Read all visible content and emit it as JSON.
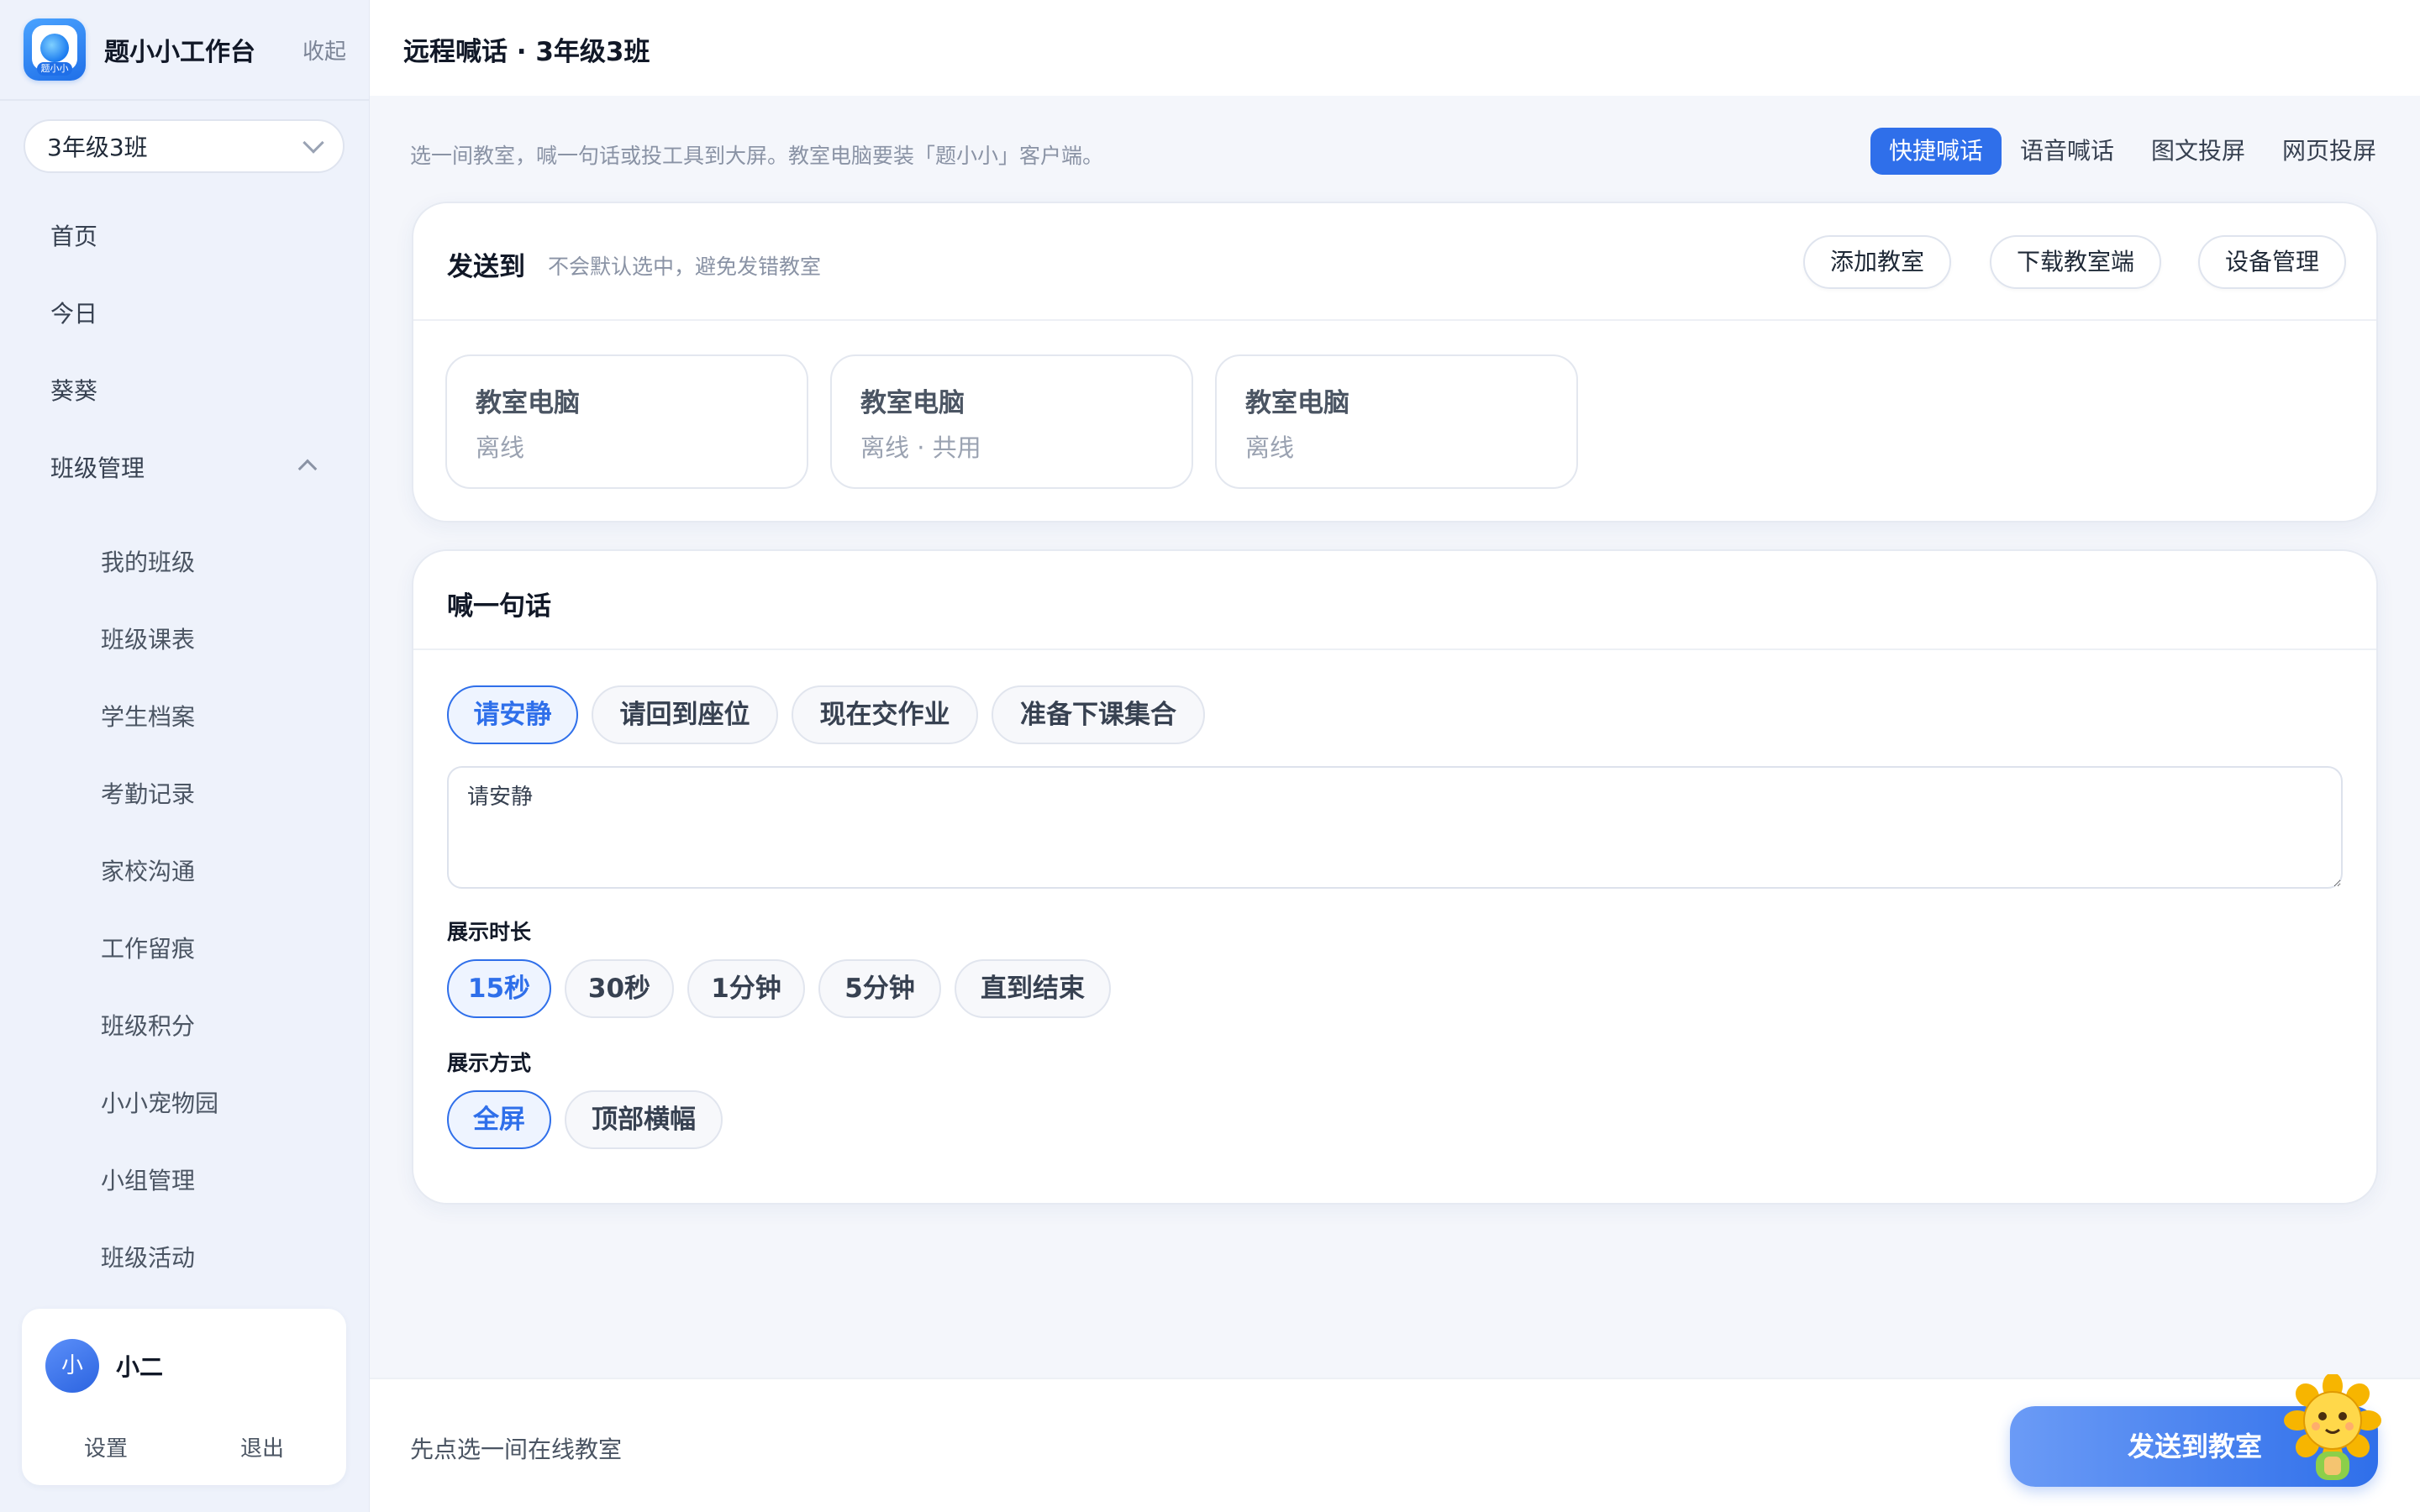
{
  "sidebar": {
    "brand_title": "题小小工作台",
    "logo_tag": "题小小",
    "collapse_label": "收起",
    "class_select": "3年级3班",
    "nav": {
      "home": "首页",
      "today": "今日",
      "kuikui": "葵葵",
      "class_mgmt": "班级管理"
    },
    "sub_items": [
      "我的班级",
      "班级课表",
      "学生档案",
      "考勤记录",
      "家校沟通",
      "工作留痕",
      "班级积分",
      "小小宠物园",
      "小组管理",
      "班级活动"
    ],
    "user": {
      "avatar_text": "小",
      "name": "小二",
      "settings": "设置",
      "logout": "退出"
    }
  },
  "header": {
    "title": "远程喊话 · 3年级3班"
  },
  "intro": "选一间教室，喊一句话或投工具到大屏。教室电脑要装「题小小」客户端。",
  "mode_tabs": [
    "快捷喊话",
    "语音喊话",
    "图文投屏",
    "网页投屏"
  ],
  "mode_active": "快捷喊话",
  "send_to": {
    "title": "发送到",
    "hint": "不会默认选中，避免发错教室",
    "buttons": {
      "add": "添加教室",
      "download": "下载教室端",
      "devices": "设备管理"
    },
    "classrooms": [
      {
        "name": "教室电脑",
        "status": "离线"
      },
      {
        "name": "教室电脑",
        "status": "离线 · 共用"
      },
      {
        "name": "教室电脑",
        "status": "离线"
      }
    ]
  },
  "shout": {
    "title": "喊一句话",
    "quick_phrases": [
      "请安静",
      "请回到座位",
      "现在交作业",
      "准备下课集合"
    ],
    "selected_phrase": "请安静",
    "message": "请安静",
    "duration_label": "展示时长",
    "durations": [
      "15秒",
      "30秒",
      "1分钟",
      "5分钟",
      "直到结束"
    ],
    "selected_duration": "15秒",
    "display_label": "展示方式",
    "display_modes": [
      "全屏",
      "顶部横幅"
    ],
    "selected_display": "全屏"
  },
  "bottom": {
    "hint": "先点选一间在线教室",
    "send_button": "发送到教室"
  },
  "colors": {
    "accent": "#2f6fea",
    "sidebar_bg": "#eef2fb",
    "page_bg": "#f4f6fb"
  }
}
